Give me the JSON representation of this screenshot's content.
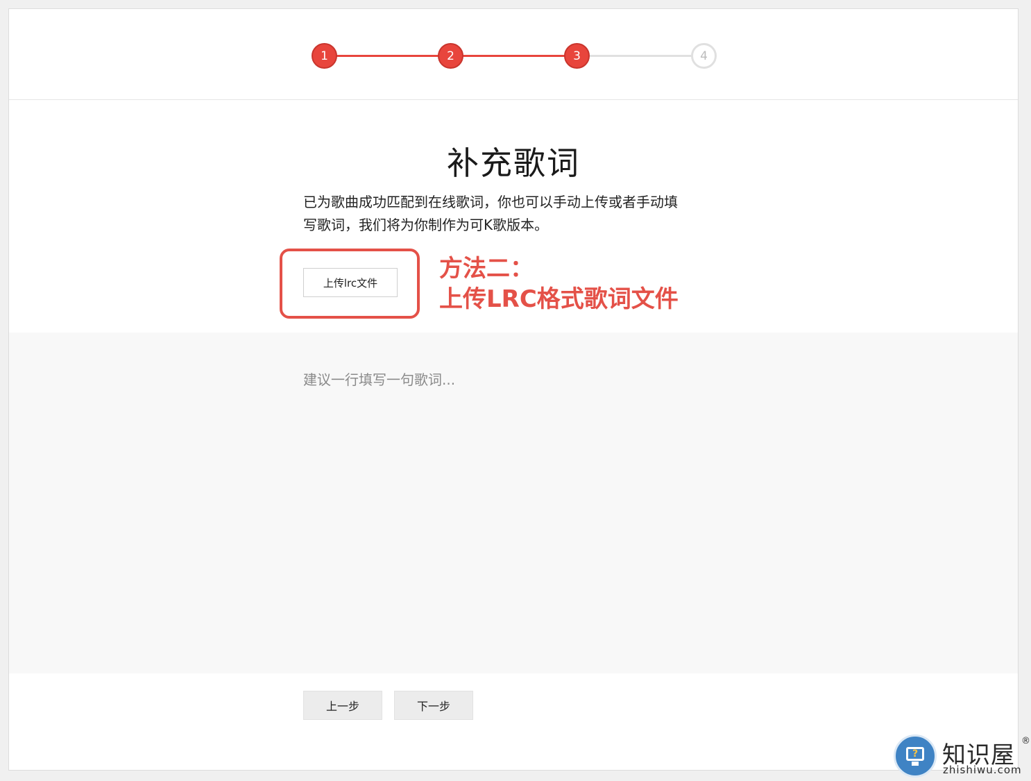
{
  "stepper": {
    "steps": [
      {
        "label": "1",
        "state": "done"
      },
      {
        "label": "2",
        "state": "done"
      },
      {
        "label": "3",
        "state": "done"
      },
      {
        "label": "4",
        "state": "todo"
      }
    ],
    "active_color": "#e8453c",
    "inactive_color": "#e0e0e0"
  },
  "main": {
    "title": "补充歌词",
    "description_line1": "已为歌曲成功匹配到在线歌词，你也可以手动上传或者手动填",
    "description_line2": "写歌词，我们将为你制作为可K歌版本。",
    "upload_label": "上传lrc文件",
    "annotation_line1": "方法二：",
    "annotation_line2": "上传LRC格式歌词文件",
    "annotation_color": "#e45148",
    "lyrics_placeholder": "建议一行填写一句歌词..."
  },
  "footer": {
    "prev_label": "上一步",
    "next_label": "下一步"
  },
  "watermark": {
    "icon": "question-monitor-icon",
    "title": "知识屋",
    "registered": "®",
    "url": "zhishiwu.com"
  }
}
